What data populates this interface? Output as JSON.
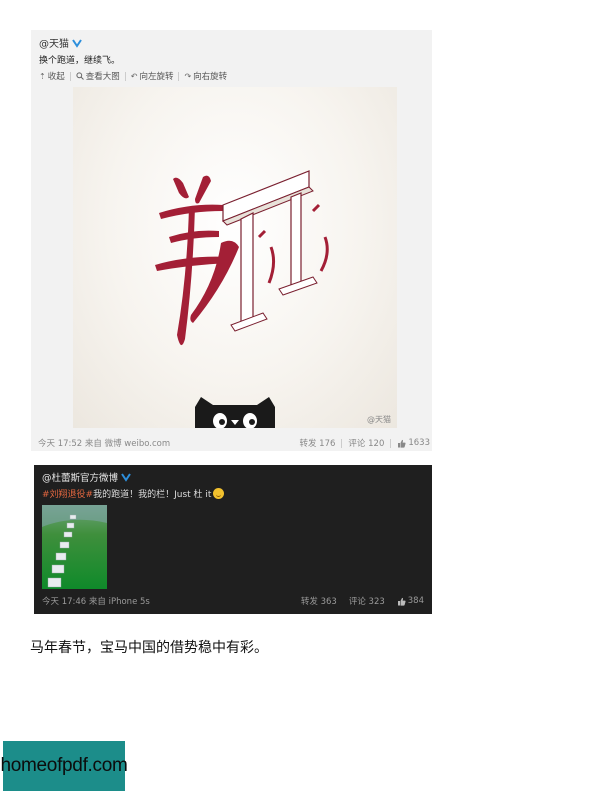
{
  "post1": {
    "user": "@天猫",
    "text": "换个跑道，继续飞。",
    "toolbar": {
      "collapse": "收起",
      "view_large": "查看大图",
      "rotate_left": "向左旋转",
      "rotate_right": "向右旋转"
    },
    "image_watermark": "@天猫",
    "time_source": "今天 17:52 来自 微博 weibo.com",
    "repost": "转发 176",
    "comment": "评论 120",
    "likes": "1633"
  },
  "post2": {
    "user": "@杜蕾斯官方微博",
    "hashtag": "#刘翔退役#",
    "text": " 我的跑道！我的栏！Just 杜 it",
    "time_source": "今天 17:46 来自 iPhone 5s",
    "repost": "转发 363",
    "comment": "评论 323",
    "likes": "384"
  },
  "caption": "马年春节，宝马中国的借势稳中有彩。",
  "logo_text": "homeofpdf.com",
  "colors": {
    "weibo_verified": "#2d8fdc",
    "calligraphy_red": "#a31f36",
    "hashtag": "#e2663f",
    "logo_bg": "#1c8d8a"
  },
  "icons": [
    "verified-icon",
    "collapse-icon",
    "magnifier-icon",
    "rotate-left-icon",
    "rotate-right-icon",
    "thumbs-up-icon",
    "wink-emoji-icon"
  ]
}
